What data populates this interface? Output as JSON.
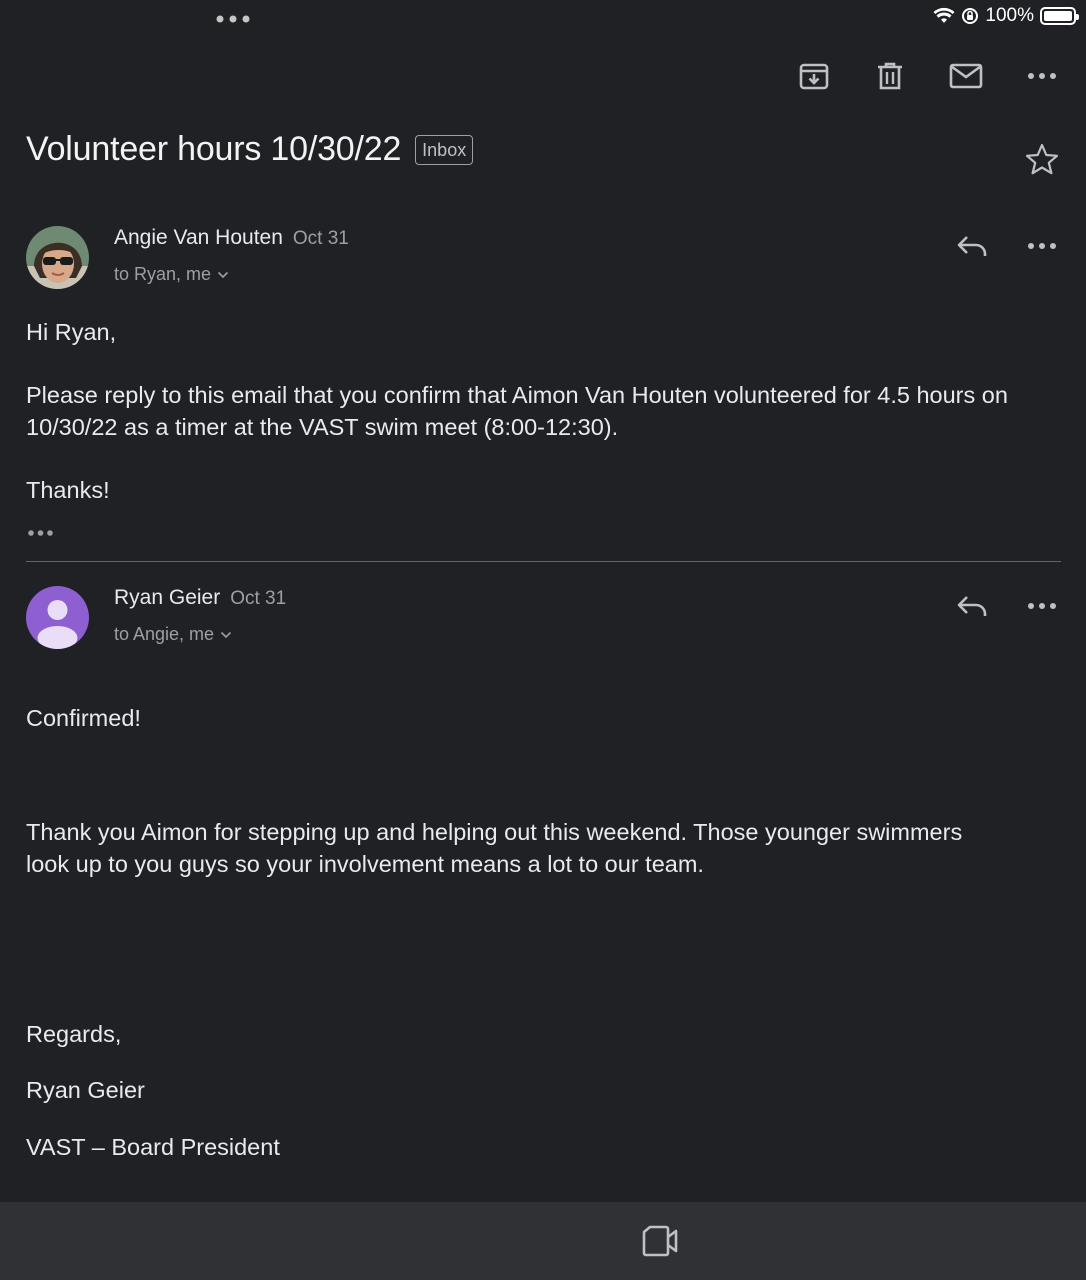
{
  "status": {
    "battery": "100%",
    "icons": [
      "multitask-dots-icon",
      "wifi-icon",
      "orientation-lock-icon",
      "battery-icon"
    ]
  },
  "toolbar": {
    "icons": [
      "archive-icon",
      "delete-icon",
      "mark-unread-icon",
      "more-icon"
    ]
  },
  "subject": "Volunteer hours 10/30/22",
  "label": "Inbox",
  "messages": [
    {
      "sender": "Angie Van Houten",
      "date": "Oct 31",
      "recipients": "to Ryan, me",
      "body": [
        "Hi Ryan,",
        "Please reply to this email that you confirm that Aimon Van Houten volunteered for 4.5 hours on 10/30/22 as a timer at the VAST swim meet (8:00-12:30).",
        "Thanks!"
      ]
    },
    {
      "sender": "Ryan Geier",
      "date": "Oct 31",
      "recipients": "to Angie, me",
      "body": [
        "Confirmed!",
        "Thank you Aimon for stepping up and helping out this weekend.  Those younger swimmers look up to you guys so your involvement means a lot to our team.",
        "Regards,",
        "Ryan Geier",
        "VAST – Board President"
      ]
    }
  ],
  "colors": {
    "background": "#202124",
    "bottom_bar": "#303134",
    "avatar_purple": "#8e5fd0",
    "muted_text": "#9aa0a6"
  }
}
